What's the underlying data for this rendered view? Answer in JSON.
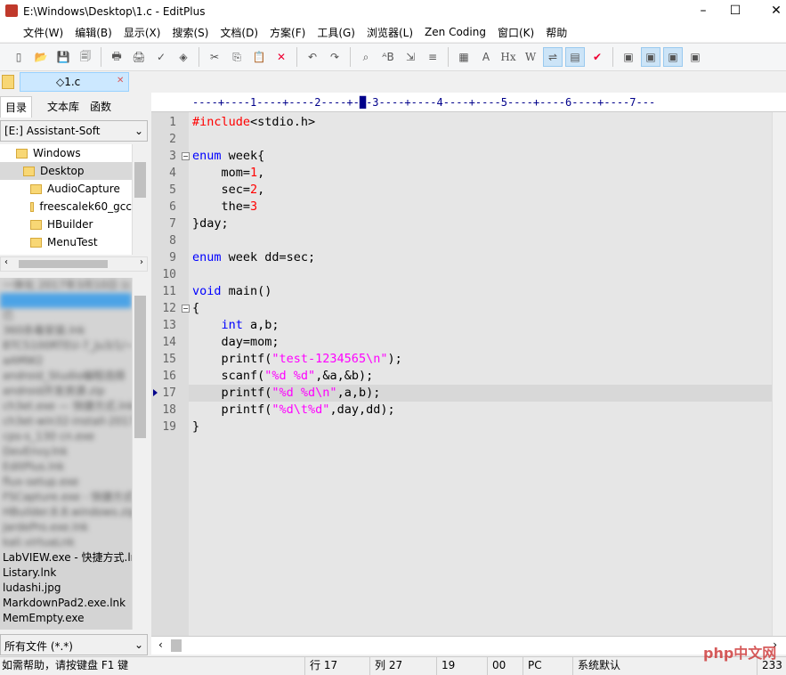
{
  "window": {
    "title": "E:\\Windows\\Desktop\\1.c - EditPlus",
    "minimize": "–",
    "maximize": "☐",
    "close": "✕"
  },
  "menu": [
    "文件(W)",
    "编辑(B)",
    "显示(X)",
    "搜索(S)",
    "文档(D)",
    "方案(F)",
    "工具(G)",
    "浏览器(L)",
    "Zen Coding",
    "窗口(K)",
    "帮助"
  ],
  "toolbar": [
    "new",
    "open",
    "save",
    "save-all",
    "|",
    "print-preview",
    "print",
    "spell-check",
    "browser-preview",
    "|",
    "cut",
    "copy",
    "paste",
    "delete",
    "|",
    "undo",
    "redo",
    "|",
    "find",
    "replace",
    "goto",
    "line-numbers",
    "|",
    "color",
    "font",
    "Hx",
    "W",
    "word-wrap",
    "column-select",
    "check",
    "|",
    "view1",
    "view2",
    "view3",
    "view4"
  ],
  "tab": {
    "label": "◇1.c",
    "close": "✕"
  },
  "sidebar": {
    "tabs": [
      "目录",
      "文本库",
      "函数"
    ],
    "drive": "[E:] Assistant-Soft",
    "tree": [
      {
        "label": "Windows",
        "indent": 1
      },
      {
        "label": "Desktop",
        "indent": 2,
        "selected": true
      },
      {
        "label": "AudioCapture",
        "indent": 3
      },
      {
        "label": "freescalek60_gcc",
        "indent": 3
      },
      {
        "label": "HBuilder",
        "indent": 3
      },
      {
        "label": "MenuTest",
        "indent": 3
      }
    ],
    "files_visible": [
      "LabVIEW.exe - 快捷方式.lnk",
      "Listary.lnk",
      "ludashi.jpg",
      "MarkdownPad2.exe.lnk",
      "MemEmpty.exe"
    ],
    "filter": "所有文件 (*.*)"
  },
  "ruler": "----+----1----+----2----+-█-3----+----4----+----5----+----6----+----7---",
  "code": [
    [
      [
        "pp",
        "#include"
      ],
      [
        "",
        "<stdio.h>"
      ]
    ],
    [],
    [
      [
        "kw",
        "enum"
      ],
      [
        "",
        " week{"
      ]
    ],
    [
      [
        "",
        "    mom="
      ],
      [
        "num",
        "1"
      ],
      [
        "",
        ","
      ]
    ],
    [
      [
        "",
        "    sec="
      ],
      [
        "num",
        "2"
      ],
      [
        "",
        ","
      ]
    ],
    [
      [
        "",
        "    the="
      ],
      [
        "num",
        "3"
      ]
    ],
    [
      [
        "",
        "}day;"
      ]
    ],
    [],
    [
      [
        "kw",
        "enum"
      ],
      [
        "",
        " week dd=sec;"
      ]
    ],
    [],
    [
      [
        "kw",
        "void"
      ],
      [
        "",
        " main()"
      ]
    ],
    [
      [
        "",
        "{"
      ]
    ],
    [
      [
        "",
        "    "
      ],
      [
        "kw",
        "int"
      ],
      [
        "",
        " a,b;"
      ]
    ],
    [
      [
        "",
        "    day=mom;"
      ]
    ],
    [
      [
        "",
        "    printf("
      ],
      [
        "str",
        "\"test-1234565\\n\""
      ],
      [
        "",
        ");"
      ]
    ],
    [
      [
        "",
        "    scanf("
      ],
      [
        "str",
        "\"%d %d\""
      ],
      [
        "",
        ",&a,&b);"
      ]
    ],
    [
      [
        "",
        "    printf("
      ],
      [
        "str",
        "\"%d %d\\n\""
      ],
      [
        "",
        ",a,b);"
      ]
    ],
    [
      [
        "",
        "    printf("
      ],
      [
        "str",
        "\"%d\\t%d\""
      ],
      [
        "",
        ",day,dd);"
      ]
    ],
    [
      [
        "",
        "}"
      ]
    ]
  ],
  "current_line": 17,
  "status": {
    "help": "如需帮助，请按键盘 F1 键",
    "row": "行 17",
    "col": "列 27",
    "lines": "19",
    "code": "00",
    "format": "PC",
    "encoding": "系统默认",
    "size": "233"
  },
  "watermark": "php中文网"
}
